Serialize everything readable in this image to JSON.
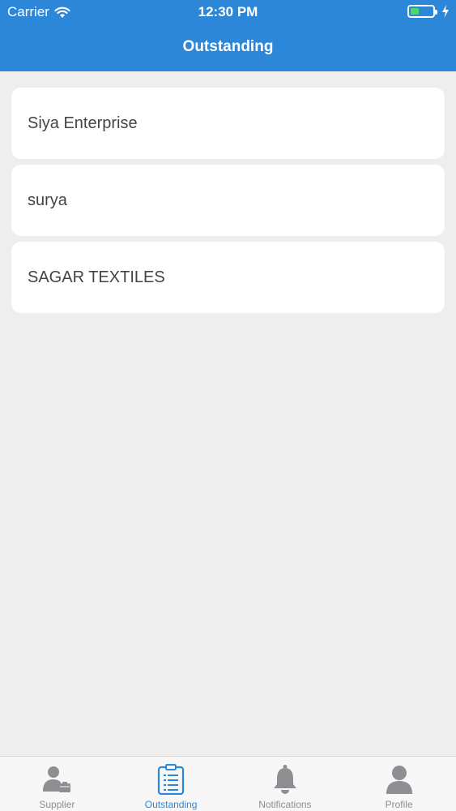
{
  "status_bar": {
    "carrier": "Carrier",
    "time": "12:30 PM",
    "battery_level": 0.4
  },
  "header": {
    "title": "Outstanding",
    "background_color": "#2d87d9"
  },
  "suppliers": [
    {
      "name": "Siya Enterprise"
    },
    {
      "name": "surya"
    },
    {
      "name": "SAGAR TEXTILES"
    }
  ],
  "tab_bar": {
    "active_color": "#2d87d9",
    "inactive_color": "#8e8e93",
    "tabs": [
      {
        "label": "Supplier",
        "icon": "supplier-icon",
        "active": false
      },
      {
        "label": "Outstanding",
        "icon": "clipboard-icon",
        "active": true
      },
      {
        "label": "Notifications",
        "icon": "bell-icon",
        "active": false
      },
      {
        "label": "Profile",
        "icon": "user-icon",
        "active": false
      }
    ]
  }
}
